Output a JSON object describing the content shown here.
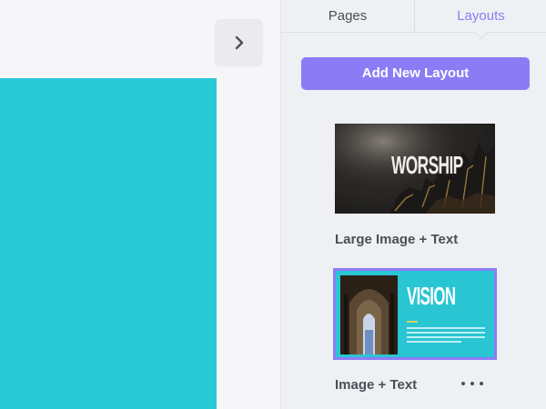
{
  "colors": {
    "canvas_background": "#f6f6f8",
    "page_fill": "#28c9d6",
    "accent": "#8b7cf6",
    "panel_background": "#eef0f3",
    "text": "#4b4f58"
  },
  "collapse_button": {
    "icon": "chevron-right-icon"
  },
  "panel": {
    "tabs": [
      {
        "label": "Pages",
        "active": false
      },
      {
        "label": "Layouts",
        "active": true
      }
    ],
    "add_button_label": "Add New Layout",
    "layouts": [
      {
        "name": "Large Image + Text",
        "thumbnail_text": "WORSHIP",
        "selected": false
      },
      {
        "name": "Image + Text",
        "thumbnail_text": "VISION",
        "selected": true,
        "more_icon": "more-horizontal-icon"
      }
    ]
  }
}
